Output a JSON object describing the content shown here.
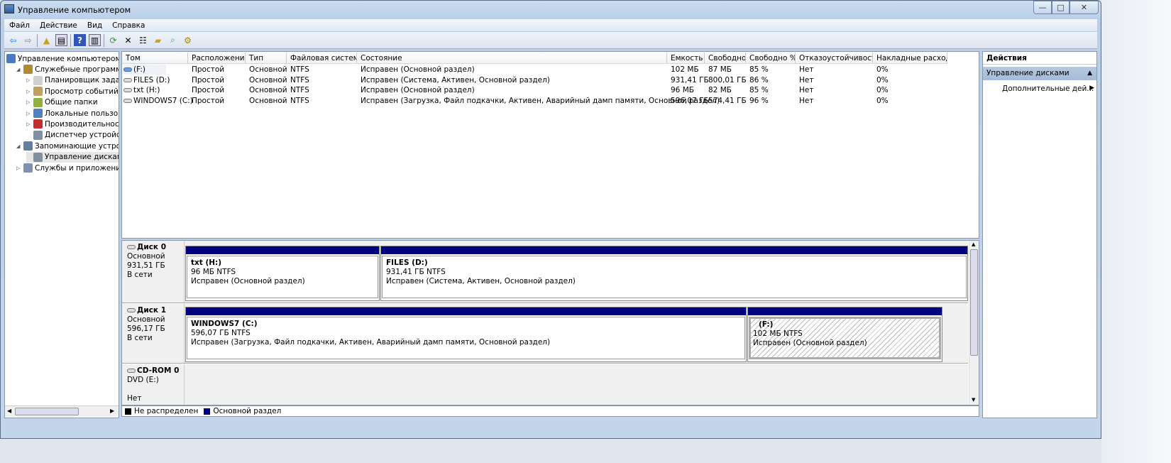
{
  "window": {
    "title": "Управление компьютером",
    "minimize": "—",
    "maximize": "□",
    "close": "✕"
  },
  "menu": [
    "Файл",
    "Действие",
    "Вид",
    "Справка"
  ],
  "toolbar": [
    "back-icon",
    "forward-icon",
    "up-icon",
    "show-hide-tree-icon",
    "help-icon",
    "show-hide-action-icon",
    "refresh-icon",
    "delete-icon",
    "properties-icon",
    "open-icon",
    "search-icon",
    "settings-icon"
  ],
  "tree": [
    {
      "label": "Управление компьютером (л",
      "level": 0,
      "arrow": ""
    },
    {
      "label": "Служебные программы",
      "level": 1,
      "arrow": "◢"
    },
    {
      "label": "Планировщик заданий",
      "level": 2,
      "arrow": "▷"
    },
    {
      "label": "Просмотр событий",
      "level": 2,
      "arrow": "▷"
    },
    {
      "label": "Общие папки",
      "level": 2,
      "arrow": "▷"
    },
    {
      "label": "Локальные пользовате",
      "level": 2,
      "arrow": "▷"
    },
    {
      "label": "Производительность",
      "level": 2,
      "arrow": "▷"
    },
    {
      "label": "Диспетчер устройств",
      "level": 2,
      "arrow": ""
    },
    {
      "label": "Запоминающие устройст",
      "level": 1,
      "arrow": "◢"
    },
    {
      "label": "Управление дисками",
      "level": 2,
      "arrow": "",
      "selected": true
    },
    {
      "label": "Службы и приложения",
      "level": 1,
      "arrow": "▷"
    }
  ],
  "volumes": {
    "columns": [
      "Том",
      "Расположение",
      "Тип",
      "Файловая система",
      "Состояние",
      "Емкость",
      "Свободно",
      "Свободно %",
      "Отказоустойчивость",
      "Накладные расходы"
    ],
    "rows": [
      [
        "(F:)",
        "Простой",
        "Основной",
        "NTFS",
        "Исправен (Основной раздел)",
        "102 МБ",
        "87 МБ",
        "85 %",
        "Нет",
        "0%"
      ],
      [
        "FILES (D:)",
        "Простой",
        "Основной",
        "NTFS",
        "Исправен (Система, Активен, Основной раздел)",
        "931,41 ГБ",
        "800,01 ГБ",
        "86 %",
        "Нет",
        "0%"
      ],
      [
        "txt (H:)",
        "Простой",
        "Основной",
        "NTFS",
        "Исправен (Основной раздел)",
        "96 МБ",
        "82 МБ",
        "85 %",
        "Нет",
        "0%"
      ],
      [
        "WINDOWS7 (C:)",
        "Простой",
        "Основной",
        "NTFS",
        "Исправен (Загрузка, Файл подкачки, Активен, Аварийный дамп памяти, Основной раздел)",
        "596,07 ГБ",
        "574,41 ГБ",
        "96 %",
        "Нет",
        "0%"
      ]
    ]
  },
  "disks": [
    {
      "name": "Диск 0",
      "type": "Основной",
      "size": "931,51 ГБ",
      "status": "В сети",
      "partitions": [
        {
          "name": "txt  (H:)",
          "size": "96 МБ NTFS",
          "status": "Исправен (Основной раздел)"
        },
        {
          "name": "FILES  (D:)",
          "size": "931,41 ГБ NTFS",
          "status": "Исправен (Система, Активен, Основной раздел)"
        }
      ]
    },
    {
      "name": "Диск 1",
      "type": "Основной",
      "size": "596,17 ГБ",
      "status": "В сети",
      "partitions": [
        {
          "name": "WINDOWS7  (C:)",
          "size": "596,07 ГБ NTFS",
          "status": "Исправен (Загрузка, Файл подкачки, Активен, Аварийный дамп памяти, Основной раздел)"
        },
        {
          "name": "(F:)",
          "size": "102 МБ NTFS",
          "status": "Исправен (Основной раздел)"
        }
      ]
    },
    {
      "name": "CD-ROM 0",
      "type": "DVD (E:)",
      "status": "Нет носителя"
    }
  ],
  "legend": [
    {
      "label": "Не распределен",
      "color": "#000000"
    },
    {
      "label": "Основной раздел",
      "color": "#000080"
    }
  ],
  "actions": {
    "header": "Действия",
    "section": "Управление дисками",
    "item": "Дополнительные дей..."
  }
}
